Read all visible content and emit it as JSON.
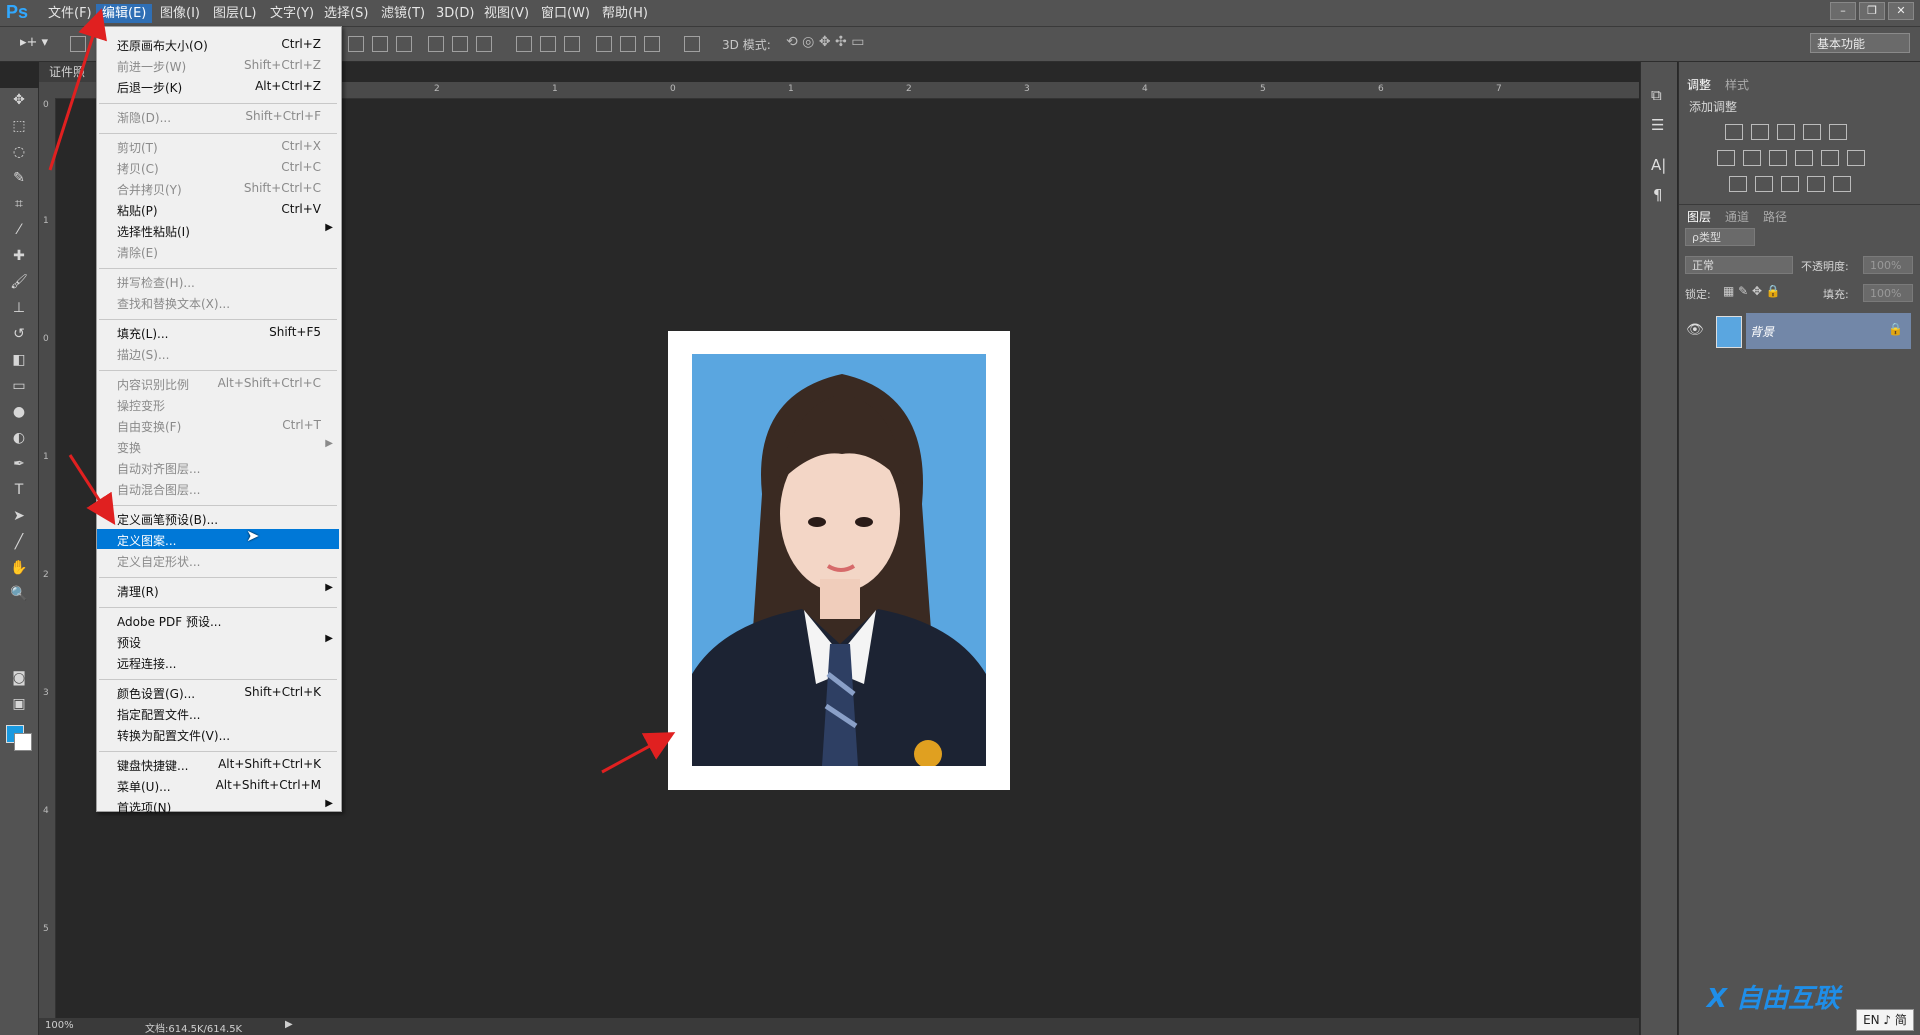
{
  "app": {
    "logo": "Ps"
  },
  "menubar": {
    "items": [
      "文件(F)",
      "编辑(E)",
      "图像(I)",
      "图层(L)",
      "文字(Y)",
      "选择(S)",
      "滤镜(T)",
      "3D(D)",
      "视图(V)",
      "窗口(W)",
      "帮助(H)"
    ]
  },
  "optbar": {
    "mode3d": "3D 模式:",
    "workspace": "基本功能"
  },
  "document": {
    "tab": "证件照",
    "zoom": "100%",
    "docsize": "文档:614.5K/614.5K"
  },
  "ruler_top_labels": [
    "2",
    "1",
    "0",
    "1",
    "2",
    "3",
    "4",
    "5",
    "6",
    "7"
  ],
  "ruler_left_labels": [
    "0",
    "1",
    "0",
    "1",
    "2",
    "3",
    "4",
    "5"
  ],
  "edit_menu": {
    "items": [
      {
        "label": "还原画布大小(O)",
        "shortcut": "Ctrl+Z",
        "disabled": false
      },
      {
        "label": "前进一步(W)",
        "shortcut": "Shift+Ctrl+Z",
        "disabled": true
      },
      {
        "label": "后退一步(K)",
        "shortcut": "Alt+Ctrl+Z",
        "disabled": false
      },
      {
        "label": "渐隐(D)...",
        "shortcut": "Shift+Ctrl+F",
        "disabled": true
      },
      {
        "label": "剪切(T)",
        "shortcut": "Ctrl+X",
        "disabled": true
      },
      {
        "label": "拷贝(C)",
        "shortcut": "Ctrl+C",
        "disabled": true
      },
      {
        "label": "合并拷贝(Y)",
        "shortcut": "Shift+Ctrl+C",
        "disabled": true
      },
      {
        "label": "粘贴(P)",
        "shortcut": "Ctrl+V",
        "disabled": false
      },
      {
        "label": "选择性粘贴(I)",
        "shortcut": "",
        "disabled": false
      },
      {
        "label": "清除(E)",
        "shortcut": "",
        "disabled": true
      },
      {
        "label": "拼写检查(H)...",
        "shortcut": "",
        "disabled": true
      },
      {
        "label": "查找和替换文本(X)...",
        "shortcut": "",
        "disabled": true
      },
      {
        "label": "填充(L)...",
        "shortcut": "Shift+F5",
        "disabled": false
      },
      {
        "label": "描边(S)...",
        "shortcut": "",
        "disabled": true
      },
      {
        "label": "内容识别比例",
        "shortcut": "Alt+Shift+Ctrl+C",
        "disabled": true
      },
      {
        "label": "操控变形",
        "shortcut": "",
        "disabled": true
      },
      {
        "label": "自由变换(F)",
        "shortcut": "Ctrl+T",
        "disabled": true
      },
      {
        "label": "变换",
        "shortcut": "",
        "disabled": true
      },
      {
        "label": "自动对齐图层...",
        "shortcut": "",
        "disabled": true
      },
      {
        "label": "自动混合图层...",
        "shortcut": "",
        "disabled": true
      },
      {
        "label": "定义画笔预设(B)...",
        "shortcut": "",
        "disabled": false
      },
      {
        "label": "定义图案...",
        "shortcut": "",
        "disabled": false
      },
      {
        "label": "定义自定形状...",
        "shortcut": "",
        "disabled": true
      },
      {
        "label": "清理(R)",
        "shortcut": "",
        "disabled": false
      },
      {
        "label": "Adobe PDF 预设...",
        "shortcut": "",
        "disabled": false
      },
      {
        "label": "预设",
        "shortcut": "",
        "disabled": false
      },
      {
        "label": "远程连接...",
        "shortcut": "",
        "disabled": false
      },
      {
        "label": "颜色设置(G)...",
        "shortcut": "Shift+Ctrl+K",
        "disabled": false
      },
      {
        "label": "指定配置文件...",
        "shortcut": "",
        "disabled": false
      },
      {
        "label": "转换为配置文件(V)...",
        "shortcut": "",
        "disabled": false
      },
      {
        "label": "键盘快捷键...",
        "shortcut": "Alt+Shift+Ctrl+K",
        "disabled": false
      },
      {
        "label": "菜单(U)...",
        "shortcut": "Alt+Shift+Ctrl+M",
        "disabled": false
      },
      {
        "label": "首选项(N)",
        "shortcut": "",
        "disabled": false
      }
    ]
  },
  "panels": {
    "adjust_tabs": [
      "调整",
      "样式"
    ],
    "add_adjust": "添加调整",
    "layer_tabs": [
      "图层",
      "通道",
      "路径"
    ],
    "filter_kind": "ρ类型",
    "blend_mode": "正常",
    "opacity_label": "不透明度:",
    "opacity_value": "100%",
    "lock_label": "锁定:",
    "fill_label": "填充:",
    "fill_value": "100%",
    "layer_name": "背景"
  },
  "watermark": "自由互联",
  "ime": "EN ♪ 简",
  "colors": {
    "accent": "#0078d7",
    "photo_bg": "#5aa6e0",
    "arrow": "#e02020"
  }
}
